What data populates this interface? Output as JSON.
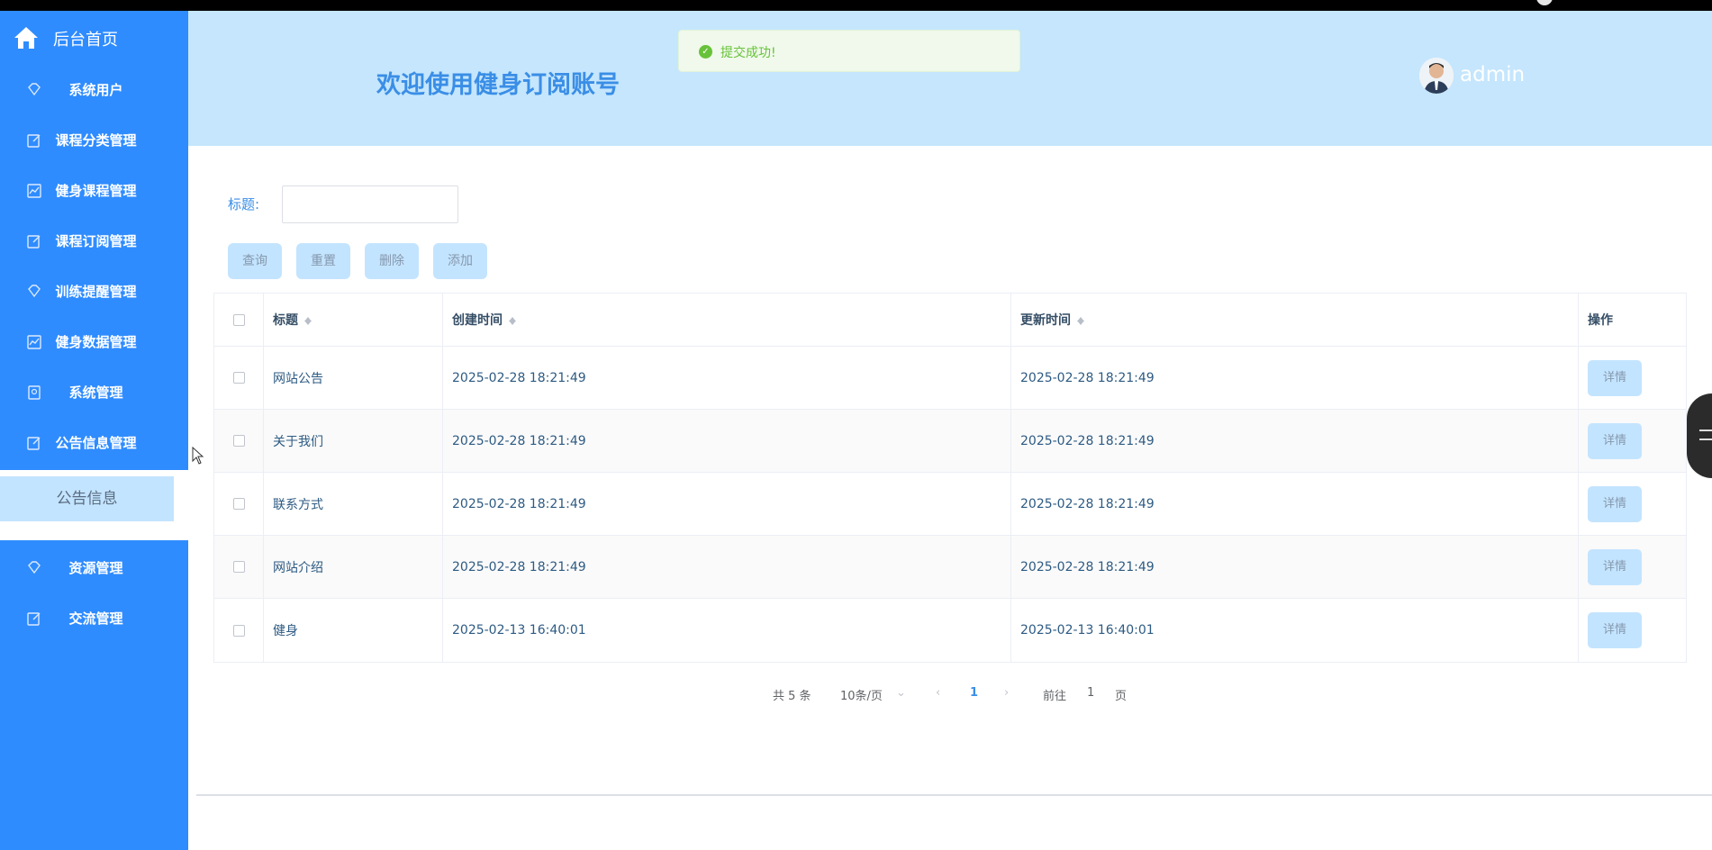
{
  "sidebar": {
    "home_label": "后台首页",
    "items": [
      {
        "label": "系统用户",
        "icon": "diamond-icon"
      },
      {
        "label": "课程分类管理",
        "icon": "edit-icon"
      },
      {
        "label": "健身课程管理",
        "icon": "chart-icon"
      },
      {
        "label": "课程订阅管理",
        "icon": "edit-icon"
      },
      {
        "label": "训练提醒管理",
        "icon": "diamond-icon"
      },
      {
        "label": "健身数据管理",
        "icon": "chart-icon"
      },
      {
        "label": "系统管理",
        "icon": "badge-icon"
      },
      {
        "label": "公告信息管理",
        "icon": "edit-icon"
      }
    ],
    "sub_item": "公告信息",
    "items_after": [
      {
        "label": "资源管理",
        "icon": "diamond-icon"
      },
      {
        "label": "交流管理",
        "icon": "edit-icon"
      }
    ]
  },
  "header": {
    "welcome": "欢迎使用健身订阅账号",
    "username": "admin"
  },
  "toast": {
    "message": "提交成功!"
  },
  "search": {
    "label": "标题:",
    "value": ""
  },
  "buttons": {
    "query": "查询",
    "reset": "重置",
    "delete": "删除",
    "add": "添加"
  },
  "table": {
    "headers": {
      "title": "标题",
      "created": "创建时间",
      "updated": "更新时间",
      "actions": "操作"
    },
    "rows": [
      {
        "title": "网站公告",
        "created": "2025-02-28 18:21:49",
        "updated": "2025-02-28 18:21:49",
        "action": "详情"
      },
      {
        "title": "关于我们",
        "created": "2025-02-28 18:21:49",
        "updated": "2025-02-28 18:21:49",
        "action": "详情"
      },
      {
        "title": "联系方式",
        "created": "2025-02-28 18:21:49",
        "updated": "2025-02-28 18:21:49",
        "action": "详情"
      },
      {
        "title": "网站介绍",
        "created": "2025-02-28 18:21:49",
        "updated": "2025-02-28 18:21:49",
        "action": "详情"
      },
      {
        "title": "健身",
        "created": "2025-02-13 16:40:01",
        "updated": "2025-02-13 16:40:01",
        "action": "详情"
      }
    ]
  },
  "pager": {
    "total": "共 5 条",
    "page_size": "10条/页",
    "current": "1",
    "goto_prefix": "前往",
    "goto_value": "1",
    "goto_suffix": "页"
  },
  "colors": {
    "sidebar": "#2f8cff",
    "header": "#c5e6fd",
    "accent": "#3a8ee6",
    "button": "#c3e4ff",
    "success": "#67c23a"
  }
}
